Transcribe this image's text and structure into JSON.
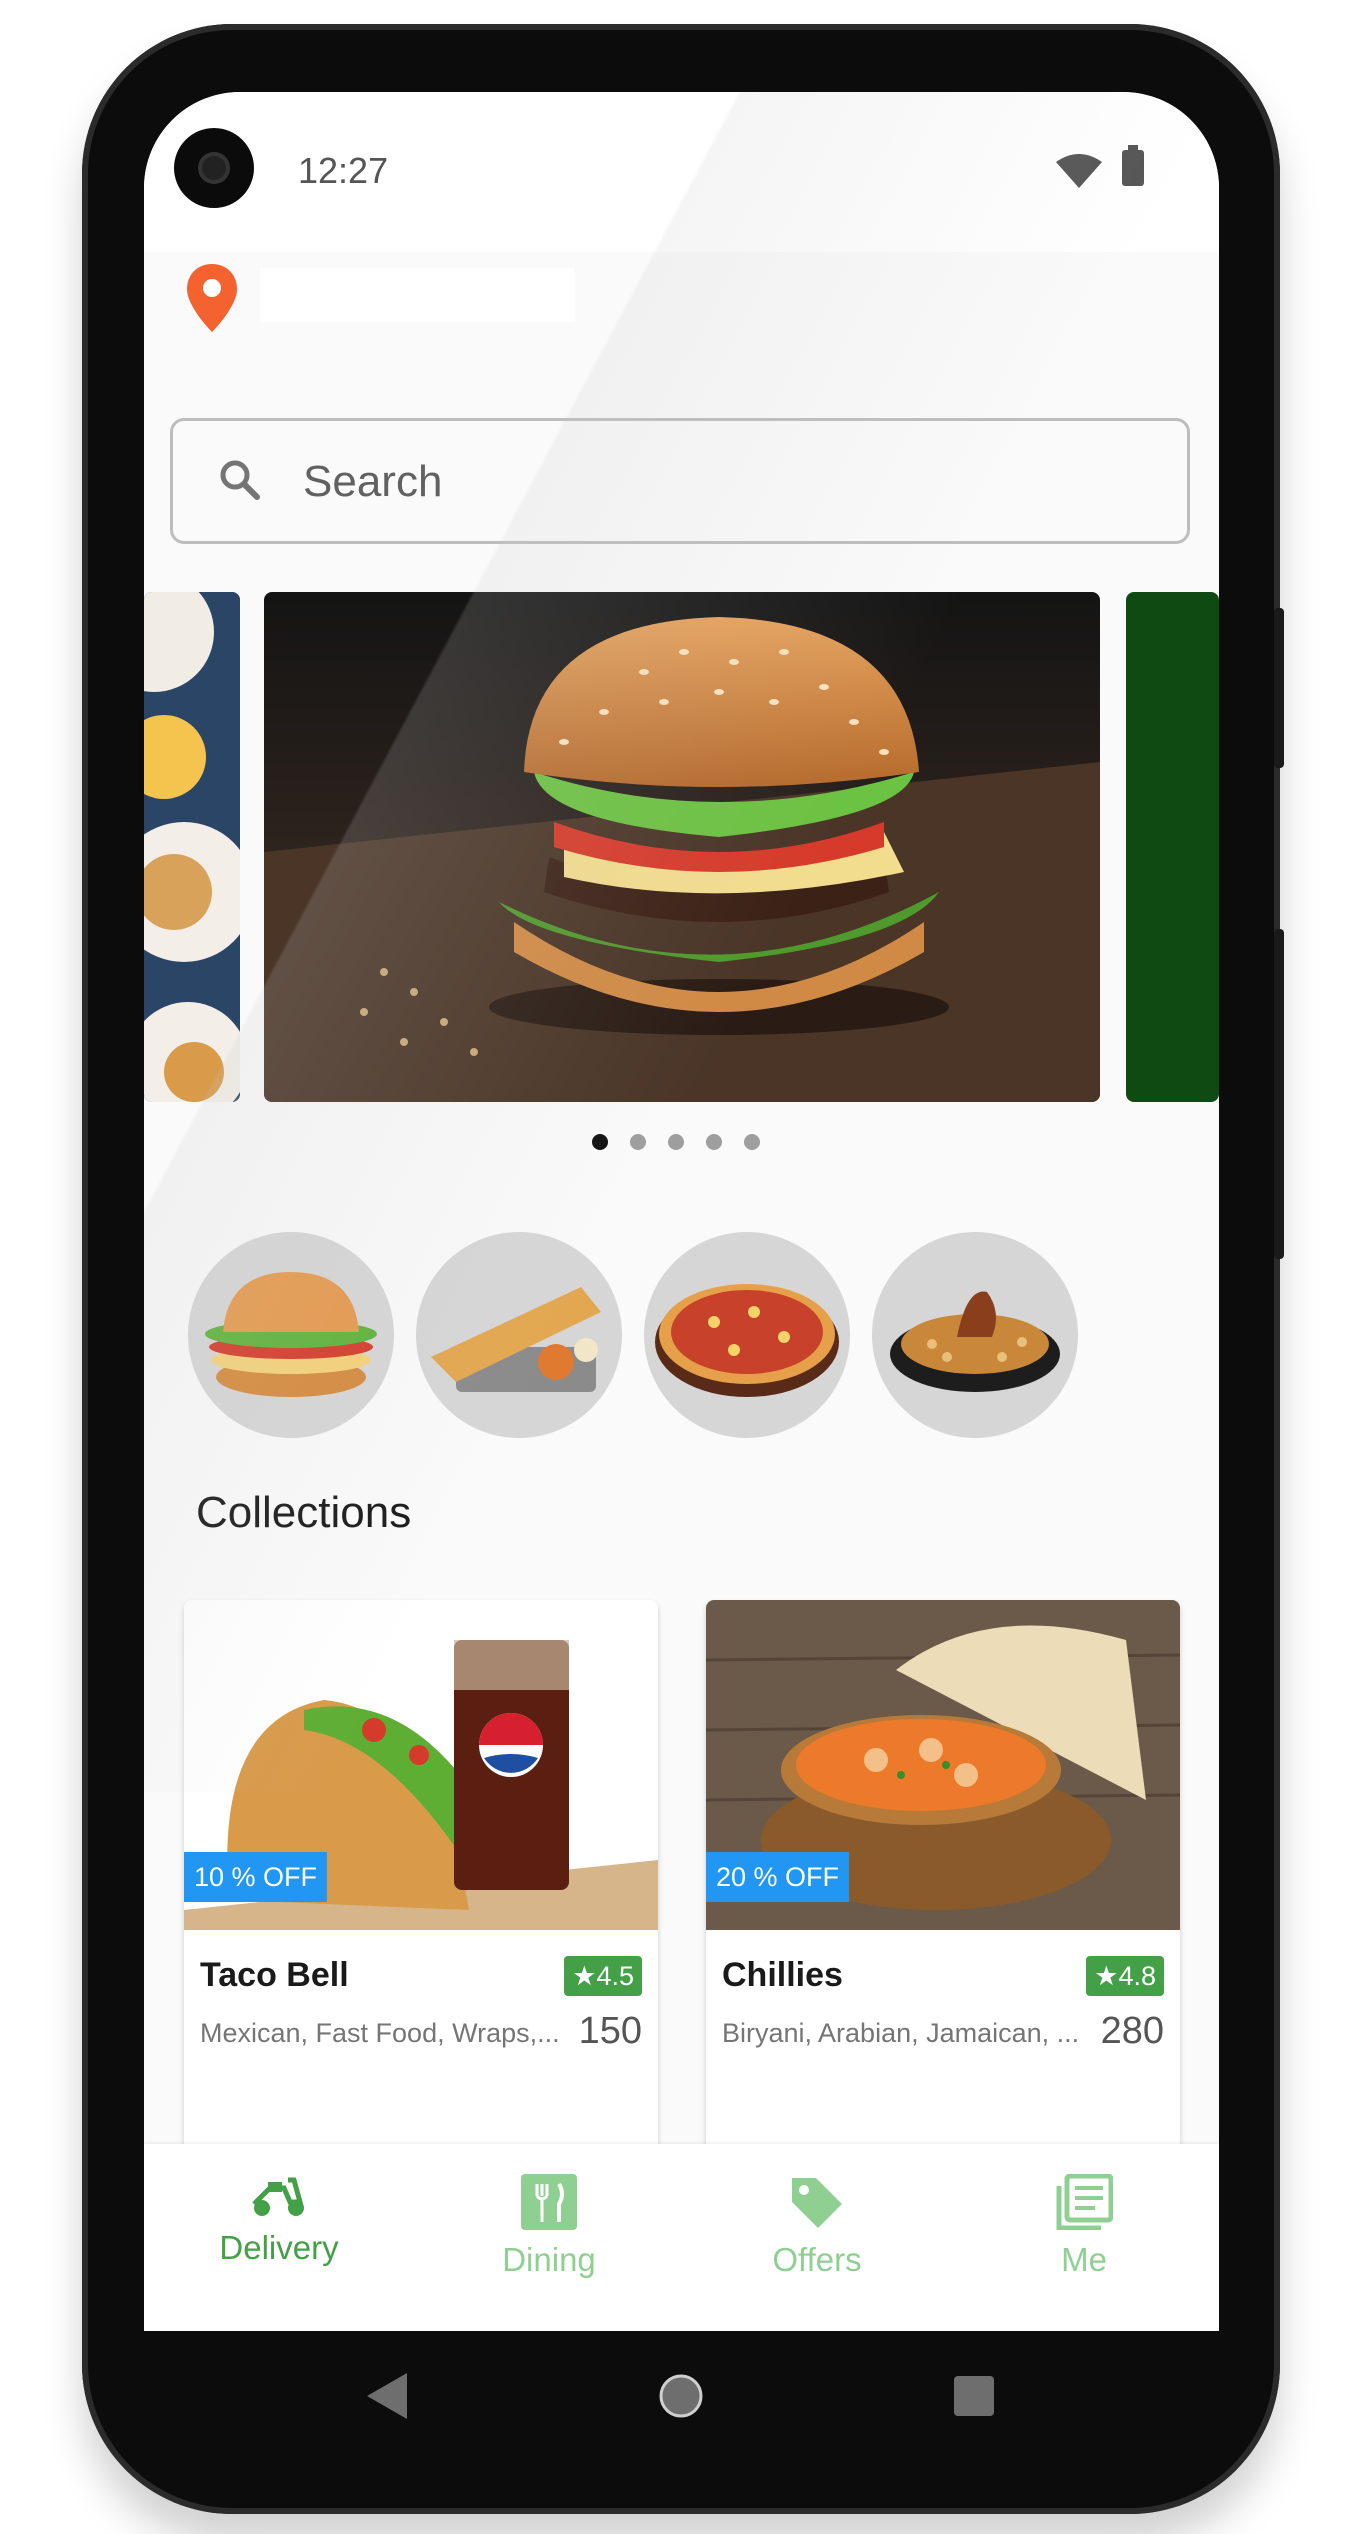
{
  "status_bar": {
    "time": "12:27"
  },
  "location": {
    "value": ""
  },
  "search": {
    "placeholder": "Search"
  },
  "carousel": {
    "slide_count": 5,
    "active_index": 0
  },
  "categories": [
    "burger-icon",
    "dosa-icon",
    "pizza-icon",
    "biryani-icon"
  ],
  "collections": {
    "title": "Collections",
    "cards": [
      {
        "name": "Taco Bell",
        "offer": "10 % OFF",
        "rating": "★4.5",
        "cuisine": "Mexican, Fast Food, Wraps,...",
        "price": "150"
      },
      {
        "name": "Chillies",
        "offer": "20 % OFF",
        "rating": "★4.8",
        "cuisine": "Biryani, Arabian, Jamaican, ...",
        "price": "280"
      }
    ]
  },
  "nav": {
    "items": [
      {
        "label": "Delivery",
        "icon": "scooter-icon",
        "active": true
      },
      {
        "label": "Dining",
        "icon": "fork-knife-icon",
        "active": false
      },
      {
        "label": "Offers",
        "icon": "tag-icon",
        "active": false
      },
      {
        "label": "Me",
        "icon": "profile-icon",
        "active": false
      }
    ]
  },
  "colors": {
    "accent": "#43a047",
    "offer_badge": "#2196f3",
    "location_pin": "#f4622f"
  }
}
